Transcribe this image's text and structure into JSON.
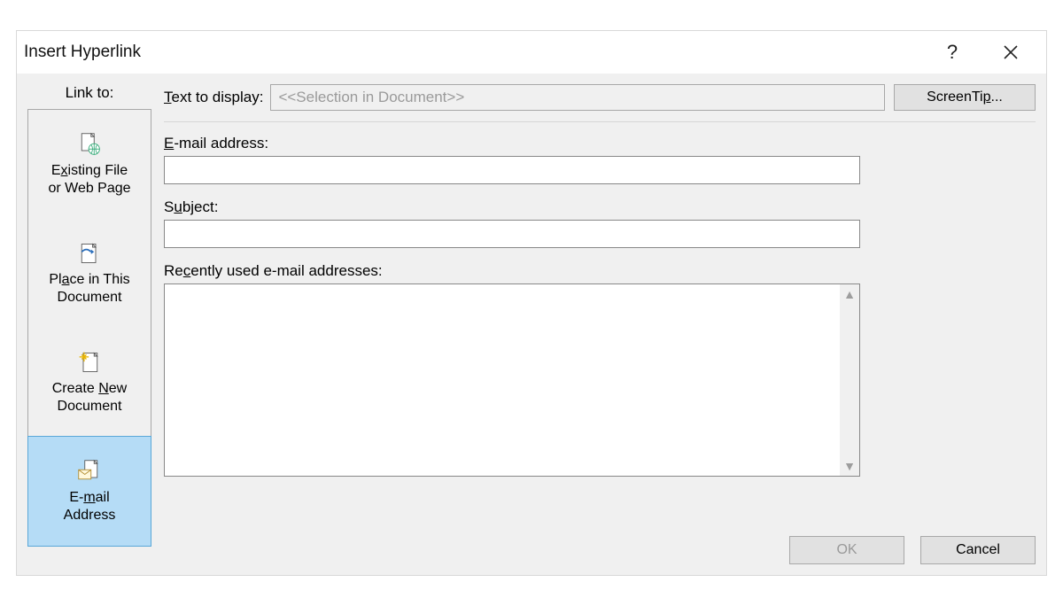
{
  "dialog": {
    "title": "Insert Hyperlink",
    "help_tooltip": "?",
    "linkto_label": "Link to:",
    "sidebar": [
      {
        "label_pre": "E",
        "label_u": "x",
        "label_post": "isting File\nor Web Page",
        "selected": false
      },
      {
        "label_pre": "Pl",
        "label_u": "a",
        "label_post": "ce in This\nDocument",
        "selected": false
      },
      {
        "label_pre": "Create ",
        "label_u": "N",
        "label_post": "ew\nDocument",
        "selected": false
      },
      {
        "label_pre": "E-",
        "label_u": "m",
        "label_post": "ail\nAddress",
        "selected": true
      }
    ],
    "text_to_display": {
      "label_pre": "",
      "label_u": "T",
      "label_post": "ext to display:",
      "value": "<<Selection in Document>>",
      "readonly": true
    },
    "screentip_label_pre": "ScreenTi",
    "screentip_label_u": "p",
    "screentip_label_post": "...",
    "email": {
      "label_pre": "",
      "label_u": "E",
      "label_post": "-mail address:",
      "value": ""
    },
    "subject": {
      "label_pre": "S",
      "label_u": "u",
      "label_post": "bject:",
      "value": ""
    },
    "recent": {
      "label_pre": "Re",
      "label_u": "c",
      "label_post": "ently used e-mail addresses:",
      "items": []
    },
    "buttons": {
      "ok": "OK",
      "cancel": "Cancel",
      "ok_enabled": false
    }
  }
}
